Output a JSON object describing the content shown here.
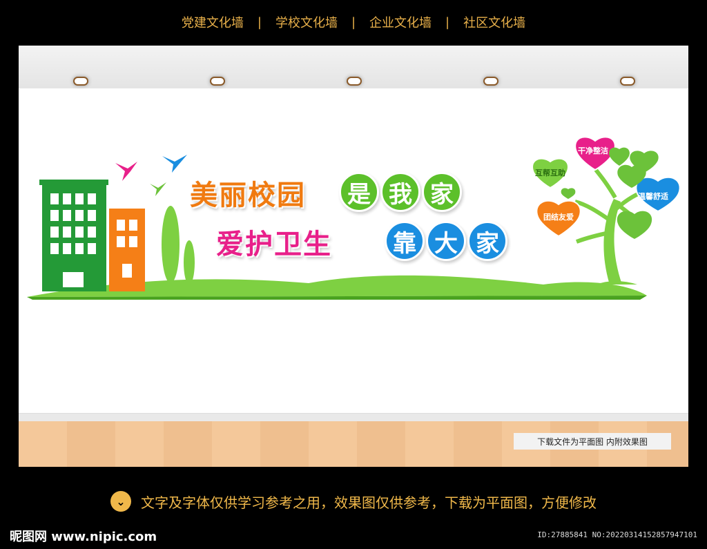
{
  "top_nav": {
    "items": [
      "党建文化墙",
      "学校文化墙",
      "企业文化墙",
      "社区文化墙"
    ],
    "separator": "|"
  },
  "slogan": {
    "line1_part1": "美丽校园",
    "line1_circles": [
      "是",
      "我",
      "家"
    ],
    "line2_part1": "爱护卫生",
    "line2_circles": [
      "靠",
      "大",
      "家"
    ]
  },
  "hearts": [
    "干净整洁",
    "互帮互助",
    "温馨舒适",
    "团结友爱"
  ],
  "note": "下载文件为平面图  内附效果图",
  "bottom_notice": "文字及字体仅供学习参考之用，效果图仅供参考，下载为平面图，方便修改",
  "footer": {
    "logo": "昵图网 www.nipic.com",
    "id_text": "ID:27885841 NO:20220314152857947101"
  },
  "colors": {
    "gold": "#e8b04a",
    "green": "#5cc02a",
    "orange": "#f07a10",
    "magenta": "#e8208a",
    "blue": "#1a8ee0"
  }
}
